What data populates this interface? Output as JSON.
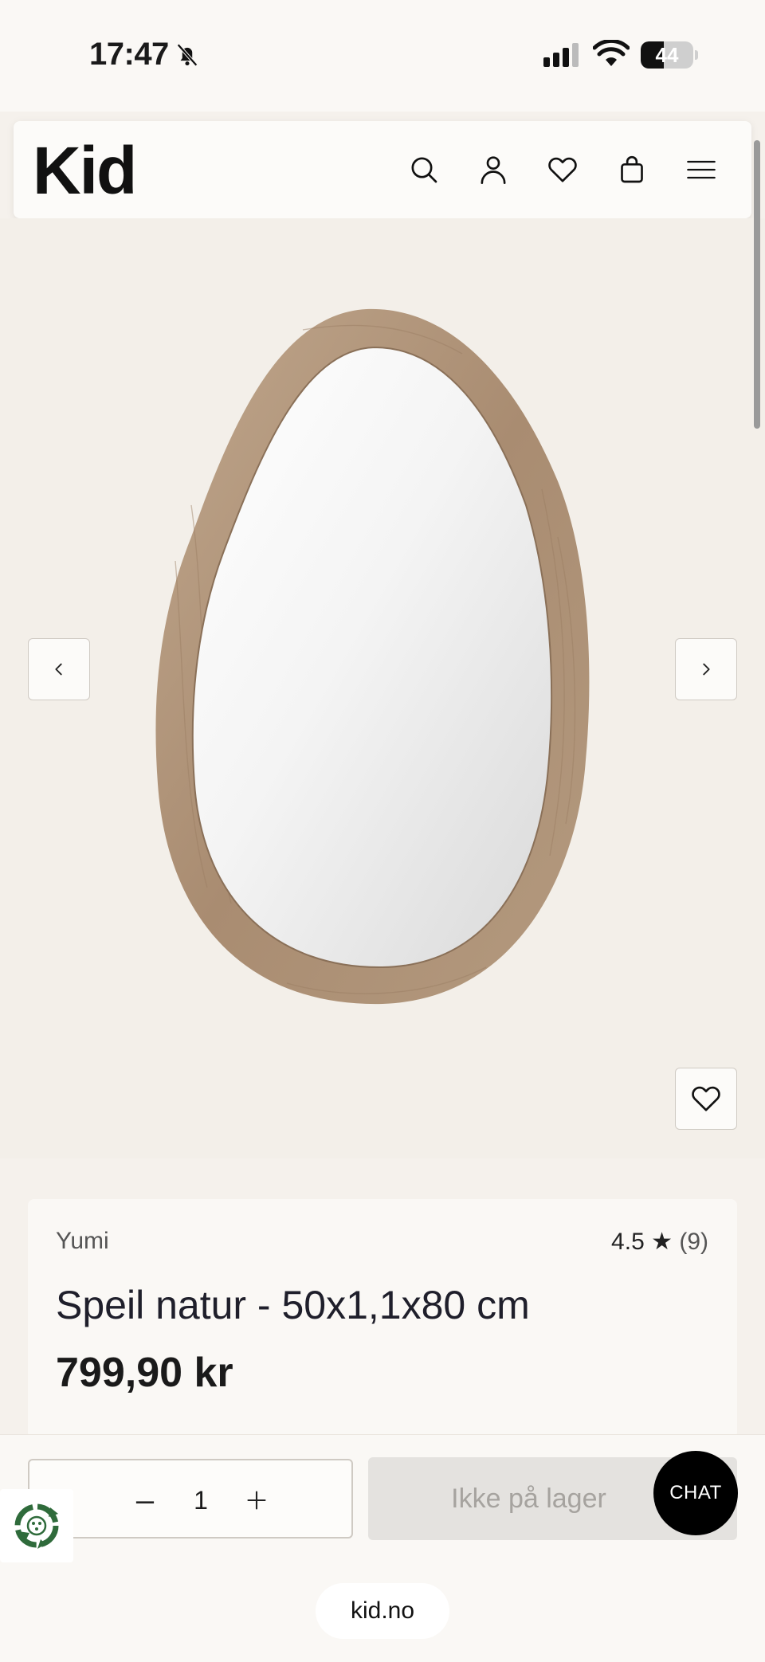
{
  "status_bar": {
    "time": "17:47",
    "battery": "44",
    "icons": [
      "bell-slash-icon",
      "signal-icon",
      "wifi-icon",
      "battery-icon"
    ]
  },
  "header": {
    "logo": "Kid",
    "icons": [
      "search-icon",
      "account-icon",
      "heart-icon",
      "bag-icon",
      "menu-icon"
    ]
  },
  "gallery": {
    "prev_icon": "chevron-left-icon",
    "next_icon": "chevron-right-icon",
    "wishlist_icon": "heart-icon"
  },
  "product": {
    "brand": "Yumi",
    "rating": "4.5 ★",
    "rating_count": "(9)",
    "title": "Speil natur - 50x1,1x80 cm",
    "price": "799,90 kr"
  },
  "purchase": {
    "minus": "–",
    "quantity": "1",
    "stock_label": "Ikke på lager",
    "chat_label": "CHAT"
  },
  "browser": {
    "url": "kid.no"
  },
  "colors": {
    "page_bg": "#f5f1ec",
    "header_bg": "#fcfbf9",
    "frame_wood": "#b09478",
    "disabled_button": "#e4e2df",
    "chat_bg": "#000000"
  }
}
